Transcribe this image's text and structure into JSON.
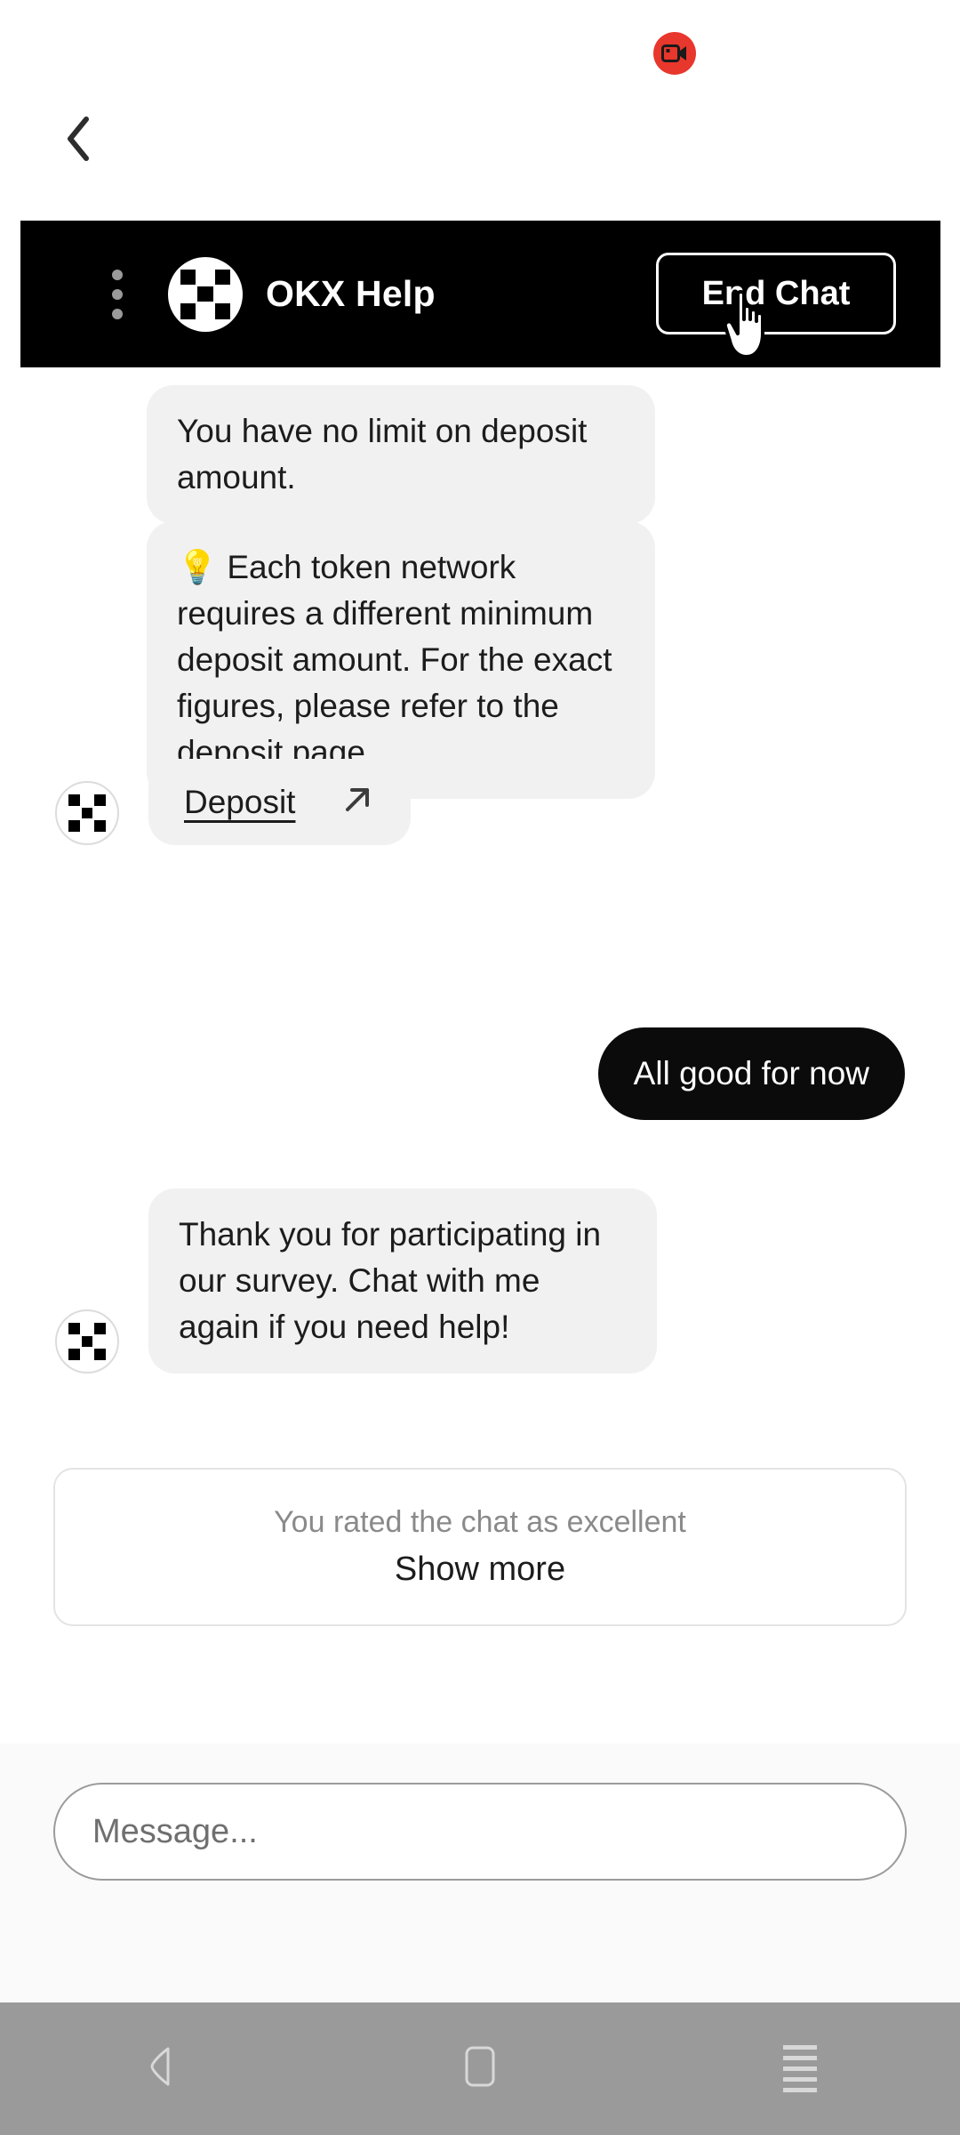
{
  "status": {
    "recording_badge": {
      "icon": "video-camera-icon",
      "color": "#e8372c"
    }
  },
  "navigation": {
    "back_chevron": "back-chevron-icon"
  },
  "chat_header": {
    "background": "#000000",
    "menu_icon": "kebab-menu-icon",
    "avatar_icon": "okx-logo-icon",
    "title": "OKX Help",
    "end_chat_label": "End Chat"
  },
  "cursor": {
    "type": "pointing-hand-cursor"
  },
  "messages": [
    {
      "id": "msg-no-limit",
      "sender": "bot",
      "text": "You have no limit on deposit amount."
    },
    {
      "id": "msg-token-network",
      "sender": "bot",
      "text": "💡 Each token network requires a different minimum deposit amount. For the exact figures, please refer to the deposit page."
    },
    {
      "id": "msg-deposit-link",
      "sender": "bot",
      "link_label": "Deposit",
      "link_icon": "external-link-arrow-icon"
    },
    {
      "id": "msg-user-allgood",
      "sender": "user",
      "text": "All good for now"
    },
    {
      "id": "msg-thankyou",
      "sender": "bot",
      "text": "Thank you for participating in our survey. Chat with me again if you need help!"
    }
  ],
  "rating_card": {
    "rating_text": "You rated the chat as excellent",
    "show_more_label": "Show more"
  },
  "composer": {
    "placeholder": "Message..."
  },
  "android_navbar": {
    "back_label": "back-triangle-icon",
    "home_label": "home-square-icon",
    "recents_label": "recents-lines-icon"
  }
}
